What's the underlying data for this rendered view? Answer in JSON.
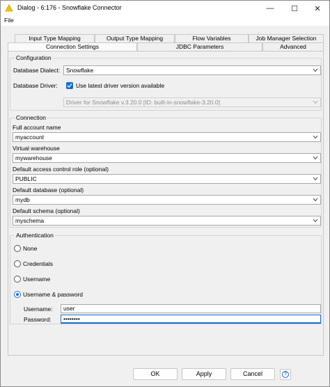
{
  "window": {
    "title": "Dialog - 6:176 - Snowflake Connector",
    "minimize_glyph": "—",
    "maximize_glyph": "☐",
    "close_glyph": "✕"
  },
  "menu": {
    "file": "File"
  },
  "tabs": {
    "row1": [
      "Input Type Mapping",
      "Output Type Mapping",
      "Flow Variables",
      "Job Manager Selection"
    ],
    "row2": [
      "Connection Settings",
      "JDBC Parameters",
      "Advanced"
    ],
    "active": "Connection Settings"
  },
  "configuration": {
    "legend": "Configuration",
    "dialect_label": "Database Dialect:",
    "dialect_value": "Snowflake",
    "driver_label": "Database Driver:",
    "latest_driver_label": "Use latest driver version available",
    "latest_driver_checked": true,
    "driver_value": "Driver for Snowflake v.3.20.0 [ID: built-in-snowflake-3.20.0]"
  },
  "connection": {
    "legend": "Connection",
    "account_label": "Full account name",
    "account_value": "myaccount",
    "warehouse_label": "Virtual warehouse",
    "warehouse_value": "mywarehouse",
    "role_label": "Default access control role (optional)",
    "role_value": "PUBLIC",
    "database_label": "Default database (optional)",
    "database_value": "mydb",
    "schema_label": "Default schema (optional)",
    "schema_value": "myschema"
  },
  "authentication": {
    "legend": "Authentication",
    "options": [
      "None",
      "Credentials",
      "Username",
      "Username & password"
    ],
    "selected": "Username & password",
    "username_label": "Username:",
    "username_value": "user",
    "password_label": "Password:",
    "password_value": "••••••••"
  },
  "buttons": {
    "ok": "OK",
    "apply": "Apply",
    "cancel": "Cancel",
    "help": "?"
  },
  "colors": {
    "accent": "#1a6fd0"
  }
}
